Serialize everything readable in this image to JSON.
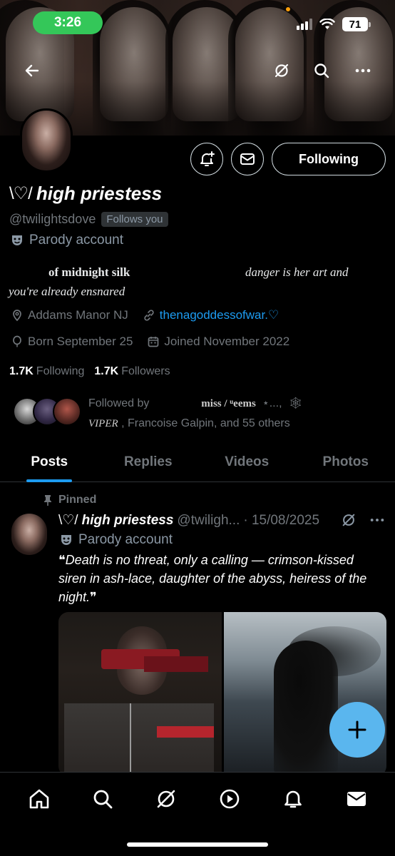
{
  "status_bar": {
    "time": "3:26",
    "battery": "71",
    "accent_color": "#34c759"
  },
  "header": {
    "back_icon": "arrow-left-icon",
    "grok_icon": "slash-circle-icon",
    "search_icon": "search-icon",
    "more_icon": "more-horizontal-icon"
  },
  "profile": {
    "name_decoration": "\\♡/",
    "display_name": "high priestess",
    "handle": "@twilightsdove",
    "follows_you": "Follows you",
    "parody_label": "Parody account",
    "following_button": "Following",
    "bio_line1_part1": "of midnight silk",
    "bio_line1_part2": "danger is her art and",
    "bio_line2": "you're already ensnared",
    "location": "Addams Manor NJ",
    "website": "thenagoddessofwar.♡",
    "birthday": "Born September 25",
    "joined": "Joined November 2022",
    "following_count": "1.7K",
    "following_label": "Following",
    "followers_count": "1.7K",
    "followers_label": "Followers",
    "followed_by_prefix": "Followed by",
    "followed_by_names_a": "miss / ᵘeems",
    "followed_by_names_b": "VIPER",
    "followed_by_suffix": ", Francoise Galpin, and 55 others"
  },
  "tabs": [
    {
      "label": "Posts",
      "active": true
    },
    {
      "label": "Replies",
      "active": false
    },
    {
      "label": "Videos",
      "active": false
    },
    {
      "label": "Photos",
      "active": false
    }
  ],
  "post": {
    "pinned_label": "Pinned",
    "name_decoration": "\\♡/",
    "author": "high priestess",
    "handle": "@twiligh...",
    "date": "· 15/08/2025",
    "parody_label": "Parody account",
    "text": "❝Death is no threat, only a calling — crimson-kissed siren in ash-lace, daughter of the abyss, heiress of the night.❞"
  },
  "colors": {
    "link": "#1d9bf0",
    "muted": "#71767b",
    "fab": "#5ab6ee"
  }
}
